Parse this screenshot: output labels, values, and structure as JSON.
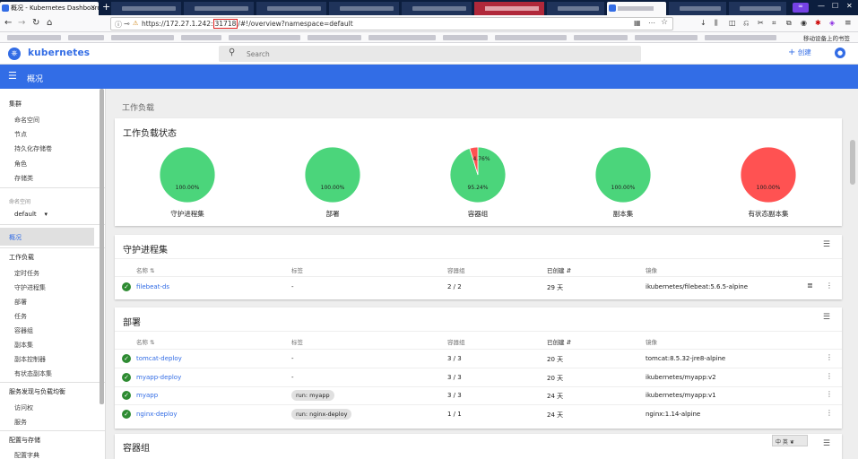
{
  "browser": {
    "tabs": [
      {
        "title": "概况 - Kubernetes Dashboard",
        "active": false
      },
      {
        "title": "",
        "active": false
      },
      {
        "title": "",
        "active": false
      },
      {
        "title": "",
        "active": true
      }
    ],
    "url": {
      "prefix": "https://172.27.1.242:",
      "port": "31718",
      "suffix": "/#!/overview?namespace=default"
    },
    "bookmark_right": "移动设备上的书签"
  },
  "app": {
    "brand": "kubernetes",
    "search_placeholder": "Search",
    "create_label": "创建",
    "page_title": "概况"
  },
  "sidebar": {
    "cluster_header": "集群",
    "cluster_items": [
      "命名空间",
      "节点",
      "持久化存储卷",
      "角色",
      "存储类"
    ],
    "namespace_label": "命名空间",
    "namespace_value": "default",
    "overview": "概况",
    "workloads_header": "工作负载",
    "workload_items": [
      "定时任务",
      "守护进程集",
      "部署",
      "任务",
      "容器组",
      "副本集",
      "副本控制器",
      "有状态副本集"
    ],
    "discovery_header": "服务发现与负载均衡",
    "discovery_items": [
      "访问权",
      "服务"
    ],
    "config_header": "配置与存储",
    "config_items": [
      "配置字典"
    ]
  },
  "main": {
    "section_title": "工作负载",
    "status_card": {
      "title": "工作负载状态",
      "charts": [
        {
          "name": "守护进程集",
          "labels": [
            "100.00%"
          ]
        },
        {
          "name": "部署",
          "labels": [
            "100.00%"
          ]
        },
        {
          "name": "容器组",
          "labels": [
            "95.24%",
            "4.76%"
          ]
        },
        {
          "name": "副本集",
          "labels": [
            "100.00%"
          ]
        },
        {
          "name": "有状态副本集",
          "labels": [
            "100.00%"
          ]
        }
      ]
    },
    "daemonsets": {
      "title": "守护进程集",
      "headers": [
        "名称",
        "标签",
        "容器组",
        "已创建",
        "镜像"
      ],
      "rows": [
        {
          "name": "filebeat-ds",
          "labels": "-",
          "pods": "2 / 2",
          "created": "29 天",
          "image": "ikubernetes/filebeat:5.6.5-alpine"
        }
      ]
    },
    "deployments": {
      "title": "部署",
      "headers": [
        "名称",
        "标签",
        "容器组",
        "已创建",
        "镜像"
      ],
      "rows": [
        {
          "name": "tomcat-deploy",
          "labels": "-",
          "pods": "3 / 3",
          "created": "20 天",
          "image": "tomcat:8.5.32-jre8-alpine"
        },
        {
          "name": "myapp-deploy",
          "labels": "-",
          "pods": "3 / 3",
          "created": "20 天",
          "image": "ikubernetes/myapp:v2"
        },
        {
          "name": "myapp",
          "labels": "run: myapp",
          "pods": "3 / 3",
          "created": "24 天",
          "image": "ikubernetes/myapp:v1"
        },
        {
          "name": "nginx-deploy",
          "labels": "run: nginx-deploy",
          "pods": "1 / 1",
          "created": "24 天",
          "image": "nginx:1.14-alpine"
        }
      ]
    },
    "pods": {
      "title": "容器组"
    }
  },
  "ime": "中 英 ❦",
  "chart_data": [
    {
      "type": "pie",
      "title": "守护进程集",
      "slices": [
        {
          "label": "100.00%",
          "value": 100.0
        }
      ]
    },
    {
      "type": "pie",
      "title": "部署",
      "slices": [
        {
          "label": "100.00%",
          "value": 100.0
        }
      ]
    },
    {
      "type": "pie",
      "title": "容器组",
      "slices": [
        {
          "label": "95.24%",
          "value": 95.24
        },
        {
          "label": "4.76%",
          "value": 4.76
        }
      ]
    },
    {
      "type": "pie",
      "title": "副本集",
      "slices": [
        {
          "label": "100.00%",
          "value": 100.0
        }
      ]
    },
    {
      "type": "pie",
      "title": "有状态副本集",
      "slices": [
        {
          "label": "100.00%",
          "value": 100.0
        }
      ]
    }
  ],
  "colors": {
    "ok": "#4bd57b",
    "fail": "#ff5252",
    "brand": "#326ce5"
  }
}
